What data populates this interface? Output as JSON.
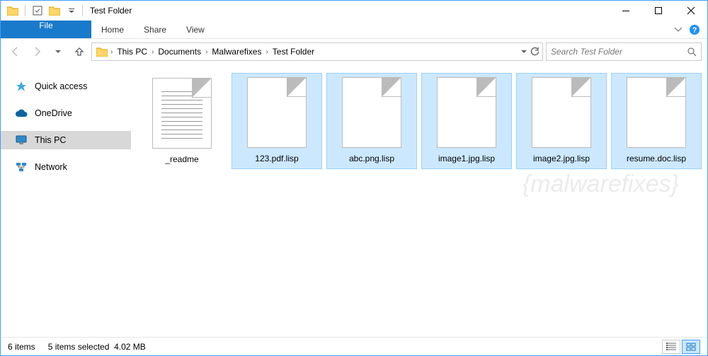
{
  "window": {
    "title": "Test Folder"
  },
  "tabs": {
    "file": "File",
    "home": "Home",
    "share": "Share",
    "view": "View"
  },
  "breadcrumb": {
    "items": [
      "This PC",
      "Documents",
      "Malwarefixes",
      "Test Folder"
    ]
  },
  "search": {
    "placeholder": "Search Test Folder"
  },
  "nav": {
    "quick": "Quick access",
    "onedrive": "OneDrive",
    "thispc": "This PC",
    "network": "Network"
  },
  "files": [
    {
      "name": "_readme",
      "selected": false,
      "text": true
    },
    {
      "name": "123.pdf.lisp",
      "selected": true,
      "text": false
    },
    {
      "name": "abc.png.lisp",
      "selected": true,
      "text": false
    },
    {
      "name": "image1.jpg.lisp",
      "selected": true,
      "text": false
    },
    {
      "name": "image2.jpg.lisp",
      "selected": true,
      "text": false
    },
    {
      "name": "resume.doc.lisp",
      "selected": true,
      "text": false
    }
  ],
  "status": {
    "count": "6 items",
    "selection": "5 items selected",
    "size": "4.02 MB"
  },
  "watermark": "{malwarefixes}"
}
